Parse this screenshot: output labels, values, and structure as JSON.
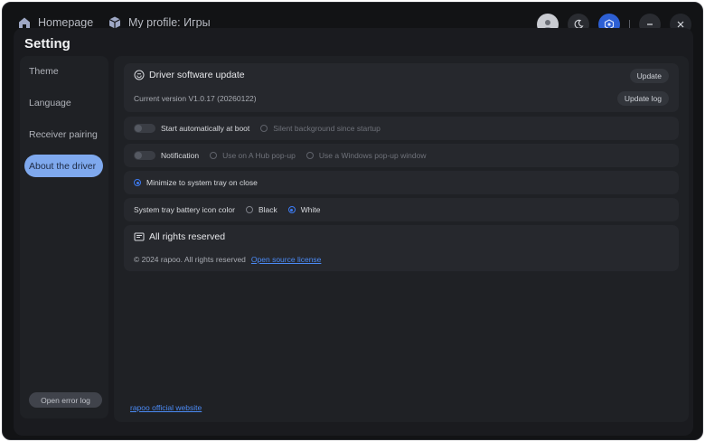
{
  "topbar": {
    "home_label": "Homepage",
    "profile_label": "My profile: Игры"
  },
  "dialog": {
    "title": "Setting",
    "sidebar": {
      "items": [
        {
          "label": "Theme"
        },
        {
          "label": "Language"
        },
        {
          "label": "Receiver pairing"
        },
        {
          "label": "About the driver",
          "active": true
        }
      ],
      "error_log_label": "Open error log"
    },
    "driver_update": {
      "title": "Driver software update",
      "update_label": "Update",
      "current_version": "Current version V1.0.17 (20260122)",
      "update_log_label": "Update log"
    },
    "startup": {
      "label": "Start automatically at boot",
      "option": "Silent background since startup"
    },
    "notification": {
      "label": "Notification",
      "options": [
        "Use on A Hub pop-up",
        "Use a Windows pop-up window"
      ]
    },
    "tray": {
      "minimize_label": "Minimize to system tray on close"
    },
    "icon_color": {
      "label": "System tray battery icon color",
      "options": [
        "Black",
        "White"
      ],
      "selected": "White"
    },
    "rights": {
      "title": "All rights reserved",
      "copyright": "© 2024 rapoo. All rights reserved",
      "license_link": "Open source license"
    },
    "official_website_link": "rapoo official website"
  },
  "colors": {
    "accent": "#3d7bf2",
    "active_tab": "#7fa9ee",
    "background": "#121315",
    "card": "#26282d"
  }
}
